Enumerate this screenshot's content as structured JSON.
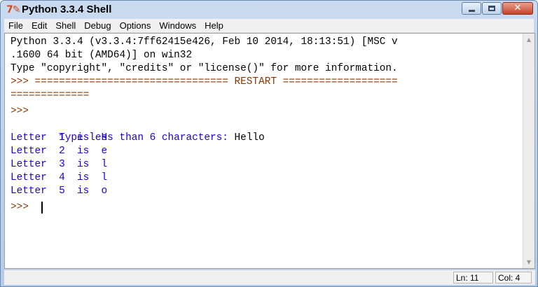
{
  "window": {
    "title": "Python 3.3.4 Shell",
    "icon_glyph": "7✎",
    "close_glyph": "✕"
  },
  "menu": [
    "File",
    "Edit",
    "Shell",
    "Debug",
    "Options",
    "Windows",
    "Help"
  ],
  "shell": {
    "lines": [
      {
        "text": "Python 3.3.4 (v3.3.4:7ff62415e426, Feb 10 2014, 18:13:51) [MSC v",
        "kind": "in"
      },
      {
        "text": ".1600 64 bit (AMD64)] on win32",
        "kind": "in"
      },
      {
        "text": "Type \"copyright\", \"credits\" or \"license()\" for more information.",
        "kind": "in"
      },
      {
        "text": ">>> ================================ RESTART ===================",
        "kind": "prompt"
      },
      {
        "text": "=============",
        "kind": "prompt"
      },
      {
        "text": ">>>",
        "kind": "prompt"
      },
      {
        "text": "Type less than 6 characters: ",
        "kind": "out",
        "input": "Hello"
      },
      {
        "text": "Letter  1  is  H",
        "kind": "out"
      },
      {
        "text": "Letter  2  is  e",
        "kind": "out"
      },
      {
        "text": "Letter  3  is  l",
        "kind": "out"
      },
      {
        "text": "Letter  4  is  l",
        "kind": "out"
      },
      {
        "text": "Letter  5  is  o",
        "kind": "out"
      },
      {
        "text": ">>> ",
        "kind": "prompt"
      }
    ]
  },
  "status": {
    "line": "Ln: 11",
    "column": "Col: 4"
  },
  "colors": {
    "prompt": "#8a3800",
    "output": "#1b00d7",
    "input": "#000000"
  }
}
